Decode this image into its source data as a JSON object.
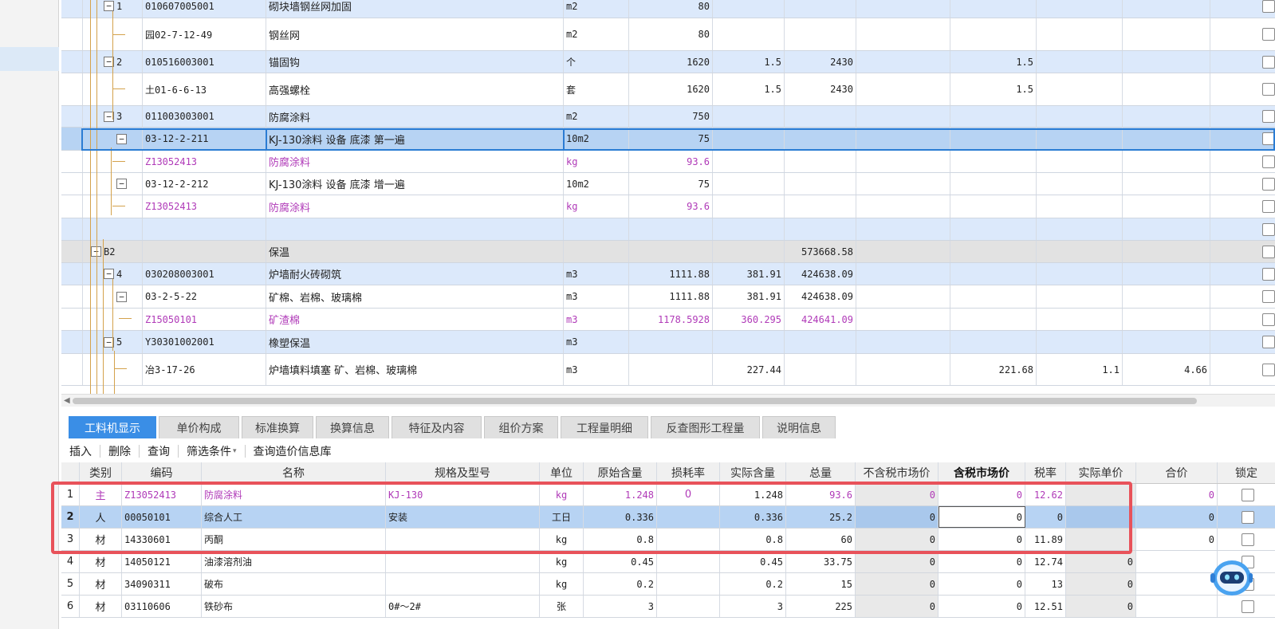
{
  "upper_rows": [
    {
      "num": "1",
      "code": "010607005001",
      "name": "砌块墙钢丝网加固",
      "unit": "m2",
      "qty": "80",
      "q2": "",
      "q3": "",
      "r1": "",
      "r2": "",
      "r3": ""
    },
    {
      "num": "",
      "code": "园02-7-12-49",
      "name": "钢丝网",
      "unit": "m2",
      "qty": "80",
      "q2": "",
      "q3": "",
      "r1": "",
      "r2": "",
      "r3": ""
    },
    {
      "num": "2",
      "code": "010516003001",
      "name": "锚固钩",
      "unit": "个",
      "qty": "1620",
      "q2": "1.5",
      "q3": "2430",
      "r1": "1.5",
      "r2": "",
      "r3": ""
    },
    {
      "num": "",
      "code": "土01-6-6-13",
      "name": "高强螺栓",
      "unit": "套",
      "qty": "1620",
      "q2": "1.5",
      "q3": "2430",
      "r1": "1.5",
      "r2": "",
      "r3": ""
    },
    {
      "num": "3",
      "code": "011003003001",
      "name": "防腐涂料",
      "unit": "m2",
      "qty": "750",
      "q2": "",
      "q3": "",
      "r1": "",
      "r2": "",
      "r3": ""
    },
    {
      "num": "",
      "code": "03-12-2-211",
      "name": "KJ-130涂料 设备 底漆 第一遍",
      "unit": "10m2",
      "qty": "75",
      "q2": "",
      "q3": "",
      "r1": "",
      "r2": "",
      "r3": ""
    },
    {
      "num": "",
      "code": "Z13052413",
      "name": "防腐涂料",
      "unit": "kg",
      "qty": "93.6",
      "q2": "",
      "q3": "",
      "r1": "",
      "r2": "",
      "r3": ""
    },
    {
      "num": "",
      "code": "03-12-2-212",
      "name": "KJ-130涂料 设备 底漆 增一遍",
      "unit": "10m2",
      "qty": "75",
      "q2": "",
      "q3": "",
      "r1": "",
      "r2": "",
      "r3": ""
    },
    {
      "num": "",
      "code": "Z13052413",
      "name": "防腐涂料",
      "unit": "kg",
      "qty": "93.6",
      "q2": "",
      "q3": "",
      "r1": "",
      "r2": "",
      "r3": ""
    },
    {
      "num": "",
      "code": "",
      "name": "",
      "unit": "",
      "qty": "",
      "q2": "",
      "q3": "",
      "r1": "",
      "r2": "",
      "r3": ""
    },
    {
      "num": "B2",
      "code": "",
      "name": "保温",
      "unit": "",
      "qty": "",
      "q2": "",
      "q3": "573668.58",
      "r1": "",
      "r2": "",
      "r3": ""
    },
    {
      "num": "4",
      "code": "030208003001",
      "name": "炉墙耐火砖砌筑",
      "unit": "m3",
      "qty": "1111.88",
      "q2": "381.91",
      "q3": "424638.09",
      "r1": "",
      "r2": "",
      "r3": ""
    },
    {
      "num": "",
      "code": "03-2-5-22",
      "name": "矿棉、岩棉、玻璃棉",
      "unit": "m3",
      "qty": "1111.88",
      "q2": "381.91",
      "q3": "424638.09",
      "r1": "",
      "r2": "",
      "r3": ""
    },
    {
      "num": "",
      "code": "Z15050101",
      "name": "矿渣棉",
      "unit": "m3",
      "qty": "1178.5928",
      "q2": "360.295",
      "q3": "424641.09",
      "r1": "",
      "r2": "",
      "r3": ""
    },
    {
      "num": "5",
      "code": "Y30301002001",
      "name": "橡塑保温",
      "unit": "m3",
      "qty": "",
      "q2": "",
      "q3": "",
      "r1": "",
      "r2": "",
      "r3": ""
    },
    {
      "num": "",
      "code": "冶3-17-26",
      "name": "炉墙填料填塞 矿、岩棉、玻璃棉",
      "unit": "m3",
      "qty": "",
      "q2": "227.44",
      "q3": "",
      "r1": "221.68",
      "r2": "1.1",
      "r3": "4.66"
    }
  ],
  "tabs": [
    "工料机显示",
    "单价构成",
    "标准换算",
    "换算信息",
    "特征及内容",
    "组价方案",
    "工程量明细",
    "反查图形工程量",
    "说明信息"
  ],
  "toolbar": {
    "insert": "插入",
    "delete": "删除",
    "query": "查询",
    "filter": "筛选条件",
    "filter_arrow": "▾",
    "price_lib": "查询造价信息库"
  },
  "lower_headers": [
    "",
    "类别",
    "编码",
    "名称",
    "规格及型号",
    "单位",
    "原始含量",
    "损耗率",
    "实际含量",
    "总量",
    "不含税市场价",
    "含税市场价",
    "税率",
    "实际单价",
    "合价",
    "锁定"
  ],
  "lower_rows": [
    {
      "idx": "1",
      "type": "主",
      "code": "Z13052413",
      "name": "防腐涂料",
      "spec": "KJ-130",
      "unit": "kg",
      "orig": "1.248",
      "loss": "0",
      "actual": "1.248",
      "total": "93.6",
      "notax": "0",
      "tax": "0",
      "rate": "12.62",
      "price": "",
      "sum": "0"
    },
    {
      "idx": "2",
      "type": "人",
      "code": "00050101",
      "name": "综合人工",
      "spec": "安装",
      "unit": "工日",
      "orig": "0.336",
      "loss": "",
      "actual": "0.336",
      "total": "25.2",
      "notax": "0",
      "tax": "0",
      "rate": "0",
      "price": "",
      "sum": "0"
    },
    {
      "idx": "3",
      "type": "材",
      "code": "14330601",
      "name": "丙酮",
      "spec": "",
      "unit": "kg",
      "orig": "0.8",
      "loss": "",
      "actual": "0.8",
      "total": "60",
      "notax": "0",
      "tax": "0",
      "rate": "11.89",
      "price": "",
      "sum": "0"
    },
    {
      "idx": "4",
      "type": "材",
      "code": "14050121",
      "name": "油漆溶剂油",
      "spec": "",
      "unit": "kg",
      "orig": "0.45",
      "loss": "",
      "actual": "0.45",
      "total": "33.75",
      "notax": "0",
      "tax": "0",
      "rate": "12.74",
      "price": "0",
      "sum": ""
    },
    {
      "idx": "5",
      "type": "材",
      "code": "34090311",
      "name": "破布",
      "spec": "",
      "unit": "kg",
      "orig": "0.2",
      "loss": "",
      "actual": "0.2",
      "total": "15",
      "notax": "0",
      "tax": "0",
      "rate": "13",
      "price": "0",
      "sum": ""
    },
    {
      "idx": "6",
      "type": "材",
      "code": "03110606",
      "name": "铁砂布",
      "spec": "0#～2#",
      "unit": "张",
      "orig": "3",
      "loss": "",
      "actual": "3",
      "total": "225",
      "notax": "0",
      "tax": "0",
      "rate": "12.51",
      "price": "0",
      "sum": ""
    }
  ],
  "colors": {
    "accent": "#3a8ee6",
    "row_blue": "#dce9fb",
    "row_selected": "#b7d3f3",
    "highlight_box": "#e8525a",
    "material_text": "#b03ab8"
  },
  "icons": {
    "expand": "minus-square-icon",
    "assistant": "robot-assistant-icon"
  }
}
